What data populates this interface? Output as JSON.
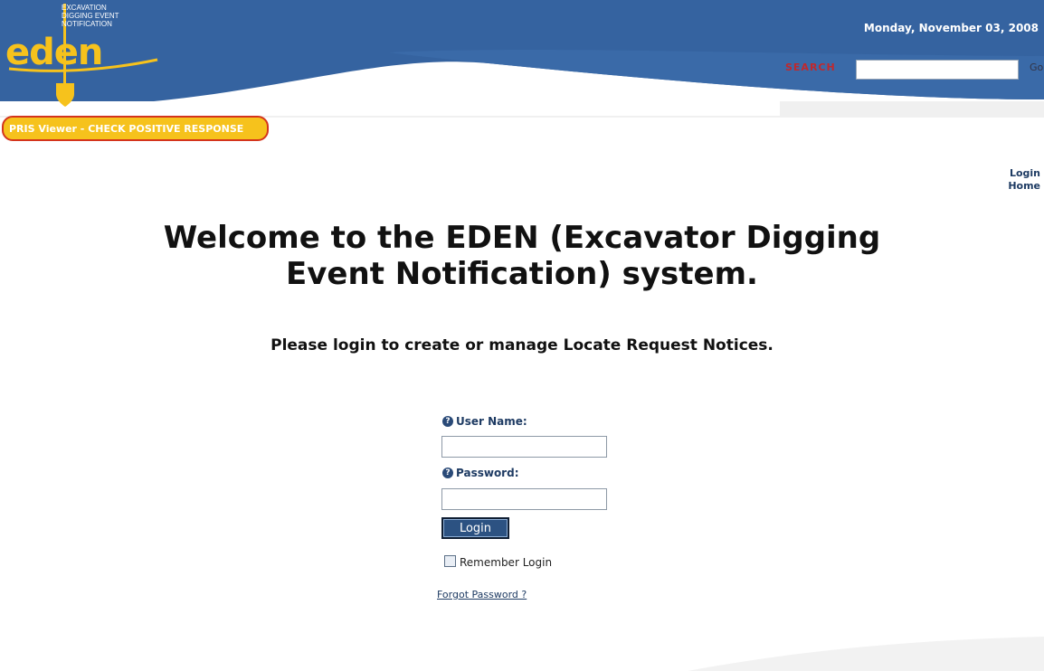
{
  "header": {
    "date": "Monday, November 03, 2008",
    "logo": {
      "line1": "Excavation",
      "line2": "Digging Event",
      "line3": "Notification",
      "wordmark": "eden"
    },
    "search": {
      "label": "SEARCH",
      "value": "",
      "go_label": "Go"
    }
  },
  "banner": {
    "pris_label": "PRIS Viewer - CHECK POSITIVE RESPONSE"
  },
  "nav": {
    "login": "Login",
    "home": "Home"
  },
  "main": {
    "title": "Welcome to the EDEN (Excavator Digging Event Notification) system.",
    "subtitle": "Please login to create or manage Locate Request Notices."
  },
  "login_form": {
    "username_label": "User Name:",
    "username_value": "",
    "password_label": "Password:",
    "password_value": "",
    "login_button": "Login",
    "remember_label": "Remember Login",
    "remember_checked": false,
    "forgot_link": "Forgot Password ?"
  },
  "colors": {
    "header_blue": "#3563a0",
    "accent_yellow": "#f6c21c",
    "accent_red": "#c0282d",
    "link_blue": "#1e3b63"
  },
  "icons": [
    "shovel-icon",
    "help-icon",
    "checkbox"
  ]
}
